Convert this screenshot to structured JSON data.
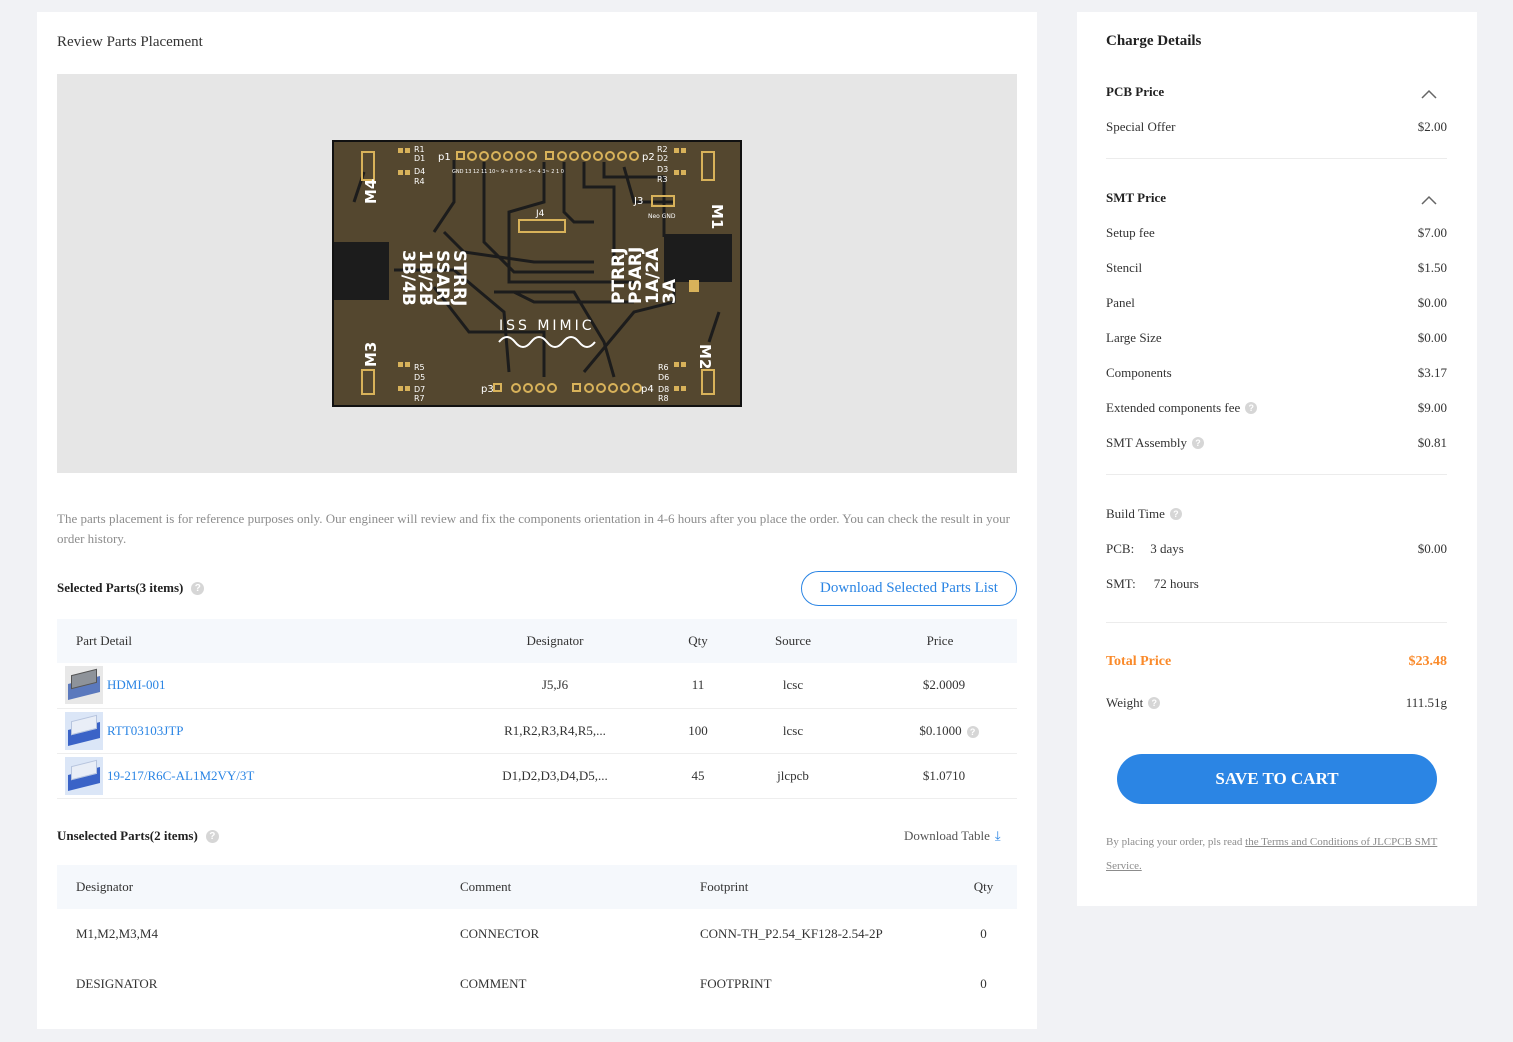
{
  "left": {
    "title": "Review Parts Placement",
    "note": "The parts placement is for reference purposes only. Our engineer will review and fix the components orientation in 4-6 hours after you place the order. You can check the result in your order history.",
    "selected": {
      "title": "Selected Parts(3 items)",
      "download_label": "Download Selected Parts List",
      "columns": [
        "Part Detail",
        "Designator",
        "Qty",
        "Source",
        "Price"
      ],
      "rows": [
        {
          "part": "HDMI-001",
          "designator": "J5,J6",
          "qty": "11",
          "source": "lcsc",
          "price": "$2.0009",
          "thumb": "hdmi"
        },
        {
          "part": "RTT03103JTP",
          "designator": "R1,R2,R3,R4,R5,...",
          "qty": "100",
          "source": "lcsc",
          "price": "$0.1000",
          "thumb": "chip",
          "help": true
        },
        {
          "part": "19-217/R6C-AL1M2VY/3T",
          "designator": "D1,D2,D3,D4,D5,...",
          "qty": "45",
          "source": "jlcpcb",
          "price": "$1.0710",
          "thumb": "chip"
        }
      ]
    },
    "unselected": {
      "title": "Unselected Parts(2 items)",
      "download_label": "Download Table",
      "columns": [
        "Designator",
        "Comment",
        "Footprint",
        "Qty"
      ],
      "rows": [
        {
          "designator": "M1,M2,M3,M4",
          "comment": "CONNECTOR",
          "footprint": "CONN-TH_P2.54_KF128-2.54-2P",
          "qty": "0"
        },
        {
          "designator": "DESIGNATOR",
          "comment": "COMMENT",
          "footprint": "FOOTPRINT",
          "qty": "0"
        }
      ]
    },
    "pcb": {
      "labels": {
        "p1": "p1",
        "p2": "p2",
        "p3": "p3",
        "p4": "p4",
        "j3": "J3",
        "j4": "J4",
        "m1": "M1",
        "m2": "M2",
        "m3": "M3",
        "m4": "M4",
        "left_block": "STRRJ\nSSARJ\n1B/2B\n3B/4B",
        "right_block": "PTRRJ\nPSARJ\n1A/2A\n3A",
        "logo": "ISS MIMIC",
        "r_top_left": "R1\nD1\nD4\nR4",
        "r_top_right": "R2\nD2\nD3\nR3",
        "r_bot_left": "R5\nD5\nD7\nR7",
        "r_bot_right": "R6\nD6\nD8\nR8",
        "neo_gnd": "Neo GND",
        "top_pins": "GND 13 12 11 10~ 9~ 8   7 6~ 5~ 4 3~ 2 1 0"
      },
      "colors": {
        "board": "#54472f",
        "trace": "#1c1c1c",
        "silk": "#ffffff",
        "pad": "#d8b25a"
      }
    }
  },
  "right": {
    "title": "Charge Details",
    "pcb_price": {
      "title": "PCB Price",
      "items": [
        {
          "label": "Special Offer",
          "value": "$2.00"
        }
      ]
    },
    "smt_price": {
      "title": "SMT Price",
      "items": [
        {
          "label": "Setup fee",
          "value": "$7.00"
        },
        {
          "label": "Stencil",
          "value": "$1.50"
        },
        {
          "label": "Panel",
          "value": "$0.00"
        },
        {
          "label": "Large Size",
          "value": "$0.00"
        },
        {
          "label": "Components",
          "value": "$3.17"
        },
        {
          "label": "Extended components fee",
          "value": "$9.00",
          "help": true
        },
        {
          "label": "SMT Assembly",
          "value": "$0.81",
          "help": true
        }
      ]
    },
    "build_time": {
      "title": "Build Time",
      "pcb_label": "PCB:",
      "pcb_days": "3 days",
      "pcb_value": "$0.00",
      "smt_label": "SMT:",
      "smt_hours": "72 hours"
    },
    "total_label": "Total Price",
    "total_value": "$23.48",
    "weight_label": "Weight",
    "weight_value": "111.51g",
    "save_label": "SAVE TO CART",
    "terms_prefix": "By placing your order, pls read ",
    "terms_link": "the Terms and Conditions of JLCPCB SMT Service."
  },
  "colors": {
    "accent": "#2b85e4",
    "total": "#fa8a2a",
    "page_bg": "#f1f2f5"
  }
}
